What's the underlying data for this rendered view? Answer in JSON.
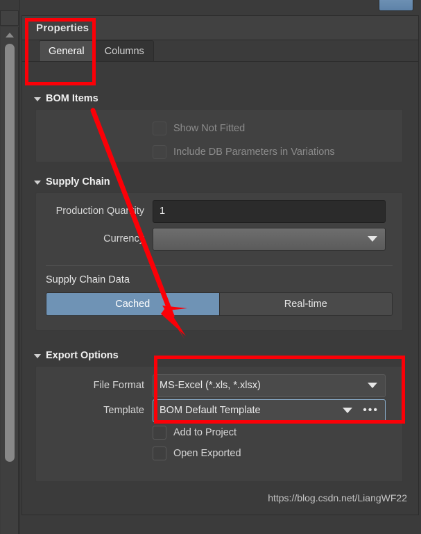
{
  "panel": {
    "title": "Properties",
    "tabs": [
      {
        "label": "General",
        "active": true
      },
      {
        "label": "Columns",
        "active": false
      }
    ]
  },
  "sections": {
    "bom_items": {
      "header": "BOM Items",
      "checkboxes": [
        {
          "label": "Show Not Fitted",
          "checked": false,
          "enabled": false
        },
        {
          "label": "Include DB Parameters in Variations",
          "checked": false,
          "enabled": false
        }
      ]
    },
    "supply_chain": {
      "header": "Supply Chain",
      "production_quantity_label": "Production Quantity",
      "production_quantity_value": "1",
      "currency_label": "Currency",
      "currency_value": "",
      "supply_chain_data_label": "Supply Chain Data",
      "toggle": {
        "cached": "Cached",
        "realtime": "Real-time",
        "selected": "Cached"
      }
    },
    "export_options": {
      "header": "Export Options",
      "file_format_label": "File Format",
      "file_format_value": "MS-Excel (*.xls, *.xlsx)",
      "template_label": "Template",
      "template_value": "BOM Default Template",
      "template_more_button": "•••",
      "checkboxes": [
        {
          "label": "Add to Project",
          "checked": false,
          "enabled": true
        },
        {
          "label": "Open Exported",
          "checked": false,
          "enabled": true
        }
      ]
    }
  },
  "watermark": "https://blog.csdn.net/LiangWF22",
  "colors": {
    "accent_blue": "#6f93b5",
    "annotation_red": "#fb0007",
    "panel_bg": "#3b3b3b",
    "group_bg": "#414141",
    "focus_border": "#8fb4d4"
  }
}
